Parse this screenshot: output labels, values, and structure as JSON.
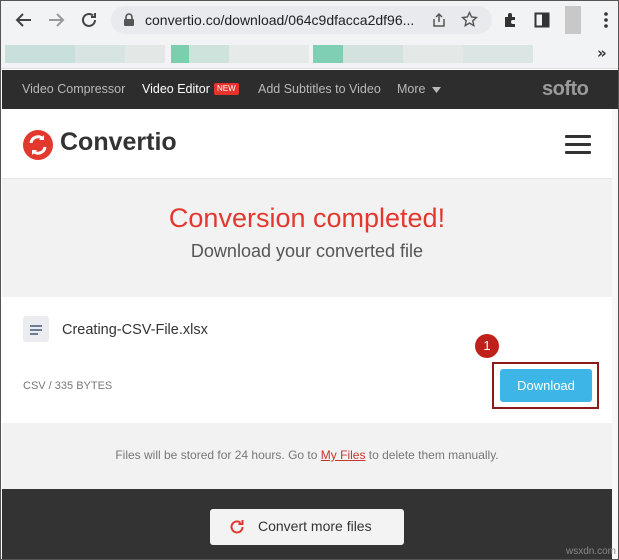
{
  "browser": {
    "url": "convertio.co/download/064c9dfacca2df96..."
  },
  "colors": {
    "accent_red": "#e2382e",
    "download_blue": "#3db5e6",
    "nav_dark": "#2d2d2d",
    "highlight_box": "#8b1a1a"
  },
  "topnav": {
    "items": [
      "Video Compressor",
      "Video Editor",
      "Add Subtitles to Video",
      "More"
    ],
    "new_badge": "NEW",
    "brand": "softo"
  },
  "header": {
    "brand": "Convertio"
  },
  "hero": {
    "title": "Conversion completed!",
    "subtitle": "Download your converted file"
  },
  "file": {
    "name": "Creating-CSV-File.xlsx",
    "meta": "CSV / 335 BYTES",
    "download_label": "Download",
    "step_marker": "1"
  },
  "notice": {
    "before": "Files will be stored for 24 hours. Go to ",
    "link": "My Files",
    "after": " to delete them manually."
  },
  "convert_more": {
    "label": "Convert more files"
  },
  "watermark": "wsxdn.com"
}
